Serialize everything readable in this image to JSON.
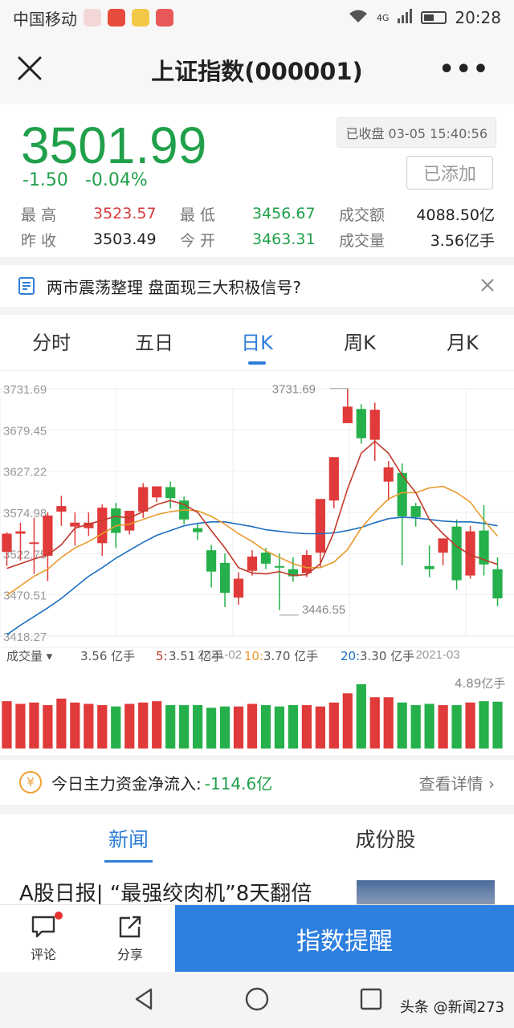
{
  "status": {
    "carrier": "中国移动",
    "net": "4G",
    "time": "20:28"
  },
  "header": {
    "title": "上证指数(000001)",
    "more": "•••"
  },
  "quote": {
    "price": "3501.99",
    "change": "-1.50",
    "change_pct": "-0.04%",
    "market_status": "已收盘 03-05 15:40:56",
    "add_label": "已添加",
    "high_label": "最高",
    "high": "3523.57",
    "low_label": "最低",
    "low": "3456.67",
    "amount_label": "成交额",
    "amount": "4088.50亿",
    "prev_label": "昨收",
    "prev": "3503.49",
    "open_label": "今开",
    "open": "3463.31",
    "volume_label": "成交量",
    "volume": "3.56亿手"
  },
  "news_tip": {
    "text": "两市震荡整理 盘面现三大积极信号?"
  },
  "tabs": [
    "分时",
    "五日",
    "日K",
    "周K",
    "月K"
  ],
  "active_tab": "日K",
  "colors": {
    "up": "#e03a3a",
    "down": "#25b04b",
    "ma5": "#c0392b",
    "ma10": "#e89a2c",
    "ma20": "#1e6fc0",
    "accent": "#2f7ed8"
  },
  "chart_data": {
    "type": "candlestick",
    "ylim": [
      3418.27,
      3731.69
    ],
    "y_ticks": [
      "3731.69",
      "3679.45",
      "3627.22",
      "3574.98",
      "3522.75",
      "3470.51",
      "3418.27"
    ],
    "x_ticks": [
      "2021-02",
      "2021-03"
    ],
    "x_tick_index": [
      16,
      32
    ],
    "max_label": "3731.69",
    "min_label": "3446.55",
    "candles": [
      [
        3525,
        3550,
        3548,
        3507
      ],
      [
        3548,
        3562,
        3551,
        3514
      ],
      [
        3535,
        3568,
        3537,
        3497
      ],
      [
        3520,
        3575,
        3571,
        3488
      ],
      [
        3576,
        3596,
        3583,
        3558
      ],
      [
        3557,
        3575,
        3562,
        3533
      ],
      [
        3555,
        3575,
        3562,
        3545
      ],
      [
        3536,
        3585,
        3581,
        3520
      ],
      [
        3580,
        3587,
        3549,
        3530
      ],
      [
        3552,
        3568,
        3577,
        3547
      ],
      [
        3576,
        3612,
        3607,
        3568
      ],
      [
        3594,
        3600,
        3608,
        3588
      ],
      [
        3607,
        3614,
        3593,
        3580
      ],
      [
        3590,
        3595,
        3566,
        3560
      ],
      [
        3555,
        3560,
        3550,
        3540
      ],
      [
        3527,
        3534,
        3500,
        3480
      ],
      [
        3511,
        3523,
        3473,
        3455
      ],
      [
        3467,
        3499,
        3491,
        3458
      ],
      [
        3501,
        3527,
        3519,
        3495
      ],
      [
        3524,
        3530,
        3510,
        3503
      ],
      [
        3507,
        3523,
        3505,
        3451
      ],
      [
        3503,
        3518,
        3494,
        3487
      ],
      [
        3498,
        3527,
        3521,
        3493
      ],
      [
        3524,
        3535,
        3592,
        3506
      ],
      [
        3590,
        3640,
        3645,
        3580
      ],
      [
        3688,
        3732,
        3709,
        3700
      ],
      [
        3706,
        3712,
        3669,
        3662
      ],
      [
        3667,
        3714,
        3705,
        3640
      ],
      [
        3614,
        3640,
        3632,
        3590
      ],
      [
        3625,
        3637,
        3570,
        3508
      ],
      [
        3583,
        3587,
        3569,
        3557
      ],
      [
        3507,
        3533,
        3503,
        3493
      ],
      [
        3524,
        3540,
        3542,
        3508
      ],
      [
        3557,
        3566,
        3489,
        3477
      ],
      [
        3495,
        3558,
        3551,
        3491
      ],
      [
        3552,
        3584,
        3509,
        3495
      ],
      [
        3503,
        3518,
        3466,
        3456
      ]
    ],
    "ma5": [
      3504,
      3510,
      3516,
      3521,
      3534,
      3555,
      3560,
      3565,
      3570,
      3568,
      3576,
      3585,
      3590,
      3585,
      3575,
      3552,
      3530,
      3505,
      3498,
      3497,
      3500,
      3495,
      3496,
      3510,
      3550,
      3605,
      3650,
      3665,
      3650,
      3622,
      3600,
      3566,
      3548,
      3532,
      3521,
      3515,
      3509
    ],
    "ma10": [
      3470,
      3482,
      3494,
      3503,
      3518,
      3530,
      3538,
      3548,
      3558,
      3560,
      3566,
      3572,
      3576,
      3578,
      3577,
      3570,
      3560,
      3548,
      3538,
      3526,
      3518,
      3510,
      3505,
      3505,
      3512,
      3528,
      3555,
      3575,
      3592,
      3600,
      3600,
      3606,
      3608,
      3600,
      3588,
      3565,
      3545
    ],
    "ma20": [
      3420,
      3432,
      3443,
      3454,
      3466,
      3480,
      3494,
      3505,
      3517,
      3527,
      3537,
      3546,
      3552,
      3558,
      3561,
      3563,
      3563,
      3560,
      3557,
      3553,
      3551,
      3549,
      3548,
      3548,
      3549,
      3552,
      3556,
      3562,
      3567,
      3569,
      3568,
      3566,
      3564,
      3563,
      3563,
      3561,
      3558
    ],
    "volume_labels": {
      "title": "成交量",
      "total": "3.56 亿手",
      "ma5_key": "5",
      "ma5": "3.51 亿手",
      "ma10_key": "10",
      "ma10": "3.70 亿手",
      "ma20_key": "20",
      "ma20": "3.30 亿手",
      "max": "4.89亿手"
    },
    "volumes": [
      3.6,
      3.4,
      3.5,
      3.3,
      3.8,
      3.5,
      3.4,
      3.3,
      3.2,
      3.4,
      3.5,
      3.6,
      3.3,
      3.3,
      3.3,
      3.1,
      3.2,
      3.2,
      3.4,
      3.3,
      3.2,
      3.3,
      3.3,
      3.2,
      3.5,
      4.2,
      4.89,
      3.9,
      3.9,
      3.5,
      3.3,
      3.4,
      3.3,
      3.3,
      3.5,
      3.6,
      3.56
    ]
  },
  "money_flow": {
    "label": "今日主力资金净流入:",
    "value": "-114.6亿",
    "detail": "查看详情 ›",
    "coin": "¥"
  },
  "news_tabs": [
    "新闻",
    "成份股"
  ],
  "headline": "A股日报| “最强绞肉机”8天翻倍",
  "bottom": {
    "comment": "评论",
    "share": "分享",
    "remind": "指数提醒"
  },
  "watermark": "头条 @新闻273"
}
